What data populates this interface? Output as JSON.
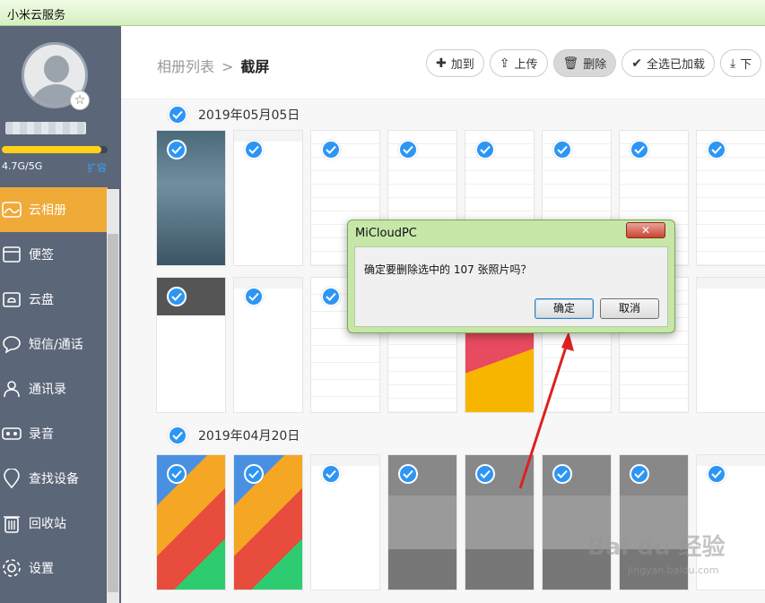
{
  "window": {
    "title": "小米云服务"
  },
  "user": {
    "storage_text": "4.7G/5G",
    "storage_fraction": 0.94,
    "expand_label": "扩容"
  },
  "sidebar": {
    "items": [
      {
        "label": "云相册",
        "icon": "photo-icon",
        "active": true
      },
      {
        "label": "便签",
        "icon": "note-icon",
        "active": false
      },
      {
        "label": "云盘",
        "icon": "cloud-drive-icon",
        "active": false
      },
      {
        "label": "短信/通话",
        "icon": "message-icon",
        "active": false
      },
      {
        "label": "通讯录",
        "icon": "contacts-icon",
        "active": false
      },
      {
        "label": "录音",
        "icon": "recorder-icon",
        "active": false
      },
      {
        "label": "查找设备",
        "icon": "location-icon",
        "active": false
      },
      {
        "label": "回收站",
        "icon": "trash-icon",
        "active": false
      },
      {
        "label": "设置",
        "icon": "gear-icon",
        "active": false
      }
    ]
  },
  "header": {
    "breadcrumb_parent": "相册列表",
    "breadcrumb_sep": ">",
    "breadcrumb_current": "截屏"
  },
  "toolbar": {
    "add": "加到",
    "upload": "上传",
    "delete": "删除",
    "select_loaded": "全选已加载",
    "download": "下"
  },
  "sections": [
    {
      "date": "2019年05月05日"
    },
    {
      "date": "2019年04月20日"
    }
  ],
  "dialog": {
    "title": "MiCloudPC",
    "close": "✕",
    "message": "确定要删除选中的 107 张照片吗？",
    "ok": "确定",
    "cancel": "取消"
  },
  "watermark": {
    "text": "Bai du 经验",
    "sub": "jingyan.baidu.com"
  },
  "colors": {
    "accent": "#2d96f5",
    "active_nav": "#efaa38",
    "sidebar": "#5b6678",
    "dialog_frame": "#c6e7a8"
  }
}
